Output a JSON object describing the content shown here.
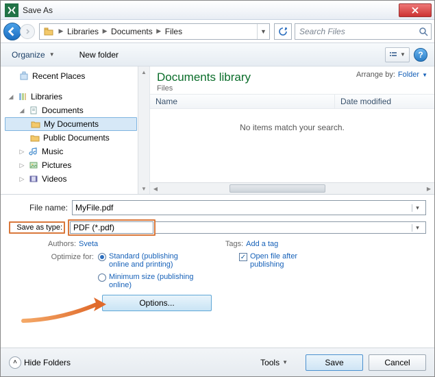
{
  "window": {
    "title": "Save As"
  },
  "nav": {
    "crumbs": [
      "Libraries",
      "Documents",
      "Files"
    ],
    "search_placeholder": "Search Files"
  },
  "toolbar": {
    "organize": "Organize",
    "new_folder": "New folder"
  },
  "tree": {
    "recent_places": "Recent Places",
    "libraries": "Libraries",
    "documents": "Documents",
    "my_documents": "My Documents",
    "public_documents": "Public Documents",
    "music": "Music",
    "pictures": "Pictures",
    "videos": "Videos"
  },
  "content": {
    "lib_title": "Documents library",
    "lib_sub": "Files",
    "arrange_label": "Arrange by:",
    "arrange_value": "Folder",
    "col_name": "Name",
    "col_date": "Date modified",
    "empty": "No items match your search."
  },
  "form": {
    "filename_label": "File name:",
    "filename_value": "MyFile.pdf",
    "savetype_label": "Save as type:",
    "savetype_value": "PDF (*.pdf)",
    "authors_label": "Authors:",
    "authors_value": "Sveta",
    "tags_label": "Tags:",
    "tags_value": "Add a tag",
    "optimize_label": "Optimize for:",
    "opt_standard": "Standard (publishing online and printing)",
    "opt_min": "Minimum size (publishing online)",
    "open_after": "Open file after publishing",
    "options_btn": "Options..."
  },
  "footer": {
    "hide_folders": "Hide Folders",
    "tools": "Tools",
    "save": "Save",
    "cancel": "Cancel"
  }
}
